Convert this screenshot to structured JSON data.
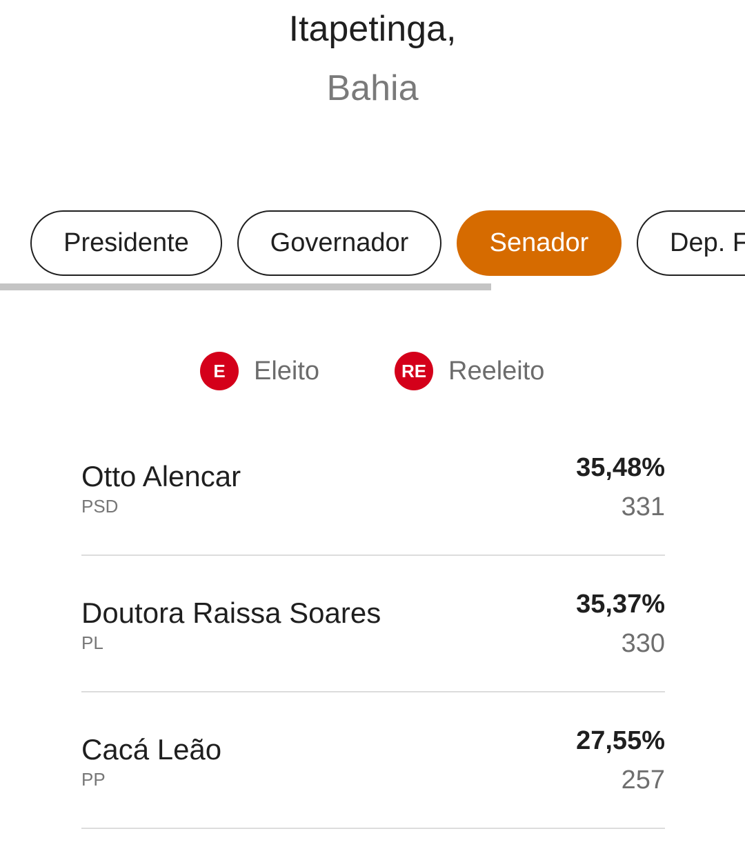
{
  "location": {
    "city": "Itapetinga,",
    "state": "Bahia"
  },
  "tabs": [
    {
      "label": "Presidente",
      "active": false
    },
    {
      "label": "Governador",
      "active": false
    },
    {
      "label": "Senador",
      "active": true
    },
    {
      "label": "Dep. F",
      "active": false
    }
  ],
  "legend": {
    "elected": {
      "badge": "E",
      "label": "Eleito"
    },
    "reelected": {
      "badge": "RE",
      "label": "Reeleito"
    }
  },
  "colors": {
    "active_tab": "#d66b00",
    "badge": "#d4001a"
  },
  "candidates": [
    {
      "name": "Otto Alencar",
      "party": "PSD",
      "percent": "35,48%",
      "votes": "331"
    },
    {
      "name": "Doutora Raissa Soares",
      "party": "PL",
      "percent": "35,37%",
      "votes": "330"
    },
    {
      "name": "Cacá Leão",
      "party": "PP",
      "percent": "27,55%",
      "votes": "257"
    }
  ]
}
